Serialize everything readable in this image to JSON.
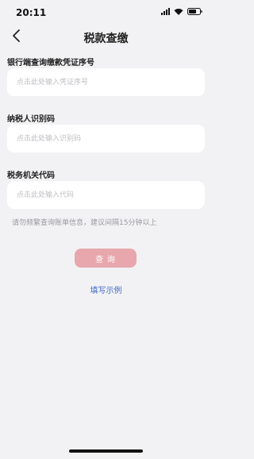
{
  "status_bar": {
    "time": "20:11"
  },
  "header": {
    "title": "税款查缴"
  },
  "form": {
    "fields": [
      {
        "label": "银行端查询缴款凭证序号",
        "placeholder": "点击此处输入凭证序号",
        "value": ""
      },
      {
        "label": "纳税人识别码",
        "placeholder": "点击此处输入识别码",
        "value": ""
      },
      {
        "label": "税务机关代码",
        "placeholder": "点击此处输入代码",
        "value": ""
      }
    ],
    "hint": "请勿频繁查询账单信息，建议间隔15分钟以上",
    "query_button": "查 询",
    "example_link": "填写示例"
  },
  "colors": {
    "background": "#f2f2f4",
    "button": "#e8a7ad",
    "link": "#4169c8"
  }
}
